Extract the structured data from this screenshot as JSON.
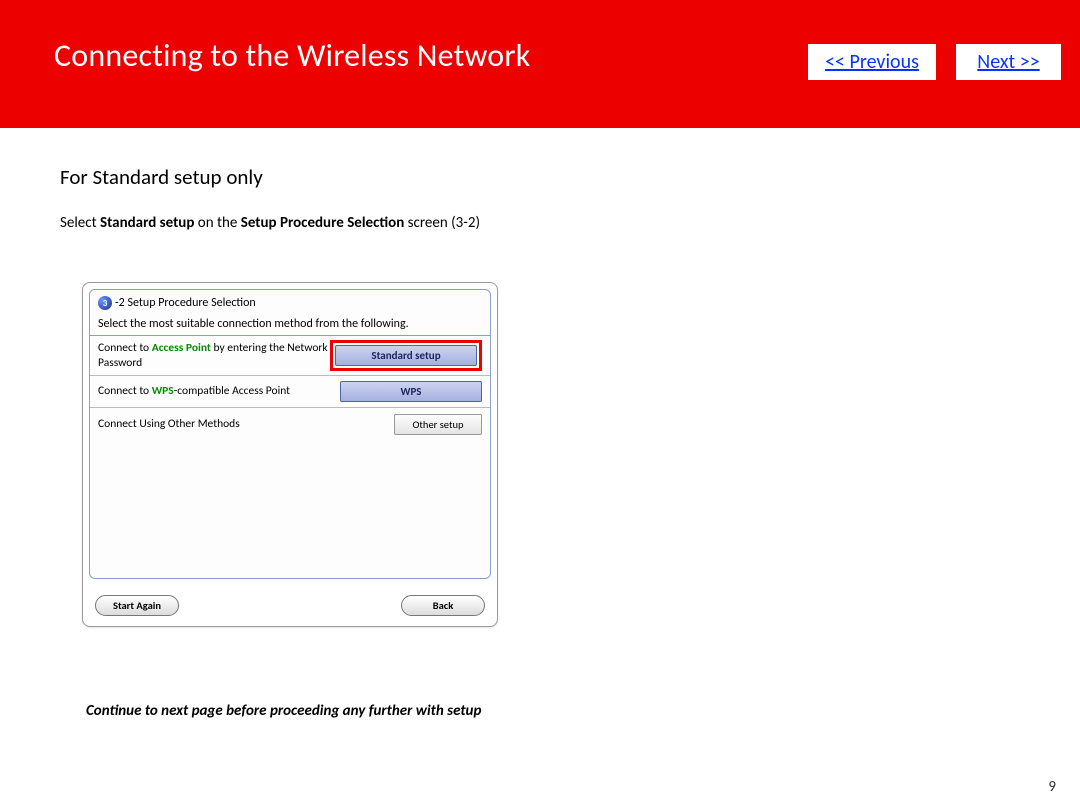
{
  "header": {
    "title": "Connecting to the Wireless Network",
    "prev_label": "<< Previous",
    "next_label": "Next >>"
  },
  "content": {
    "subheading": "For Standard setup only",
    "instruction_prefix": "Select ",
    "instruction_bold1": "Standard setup",
    "instruction_mid": " on the ",
    "instruction_bold2": "Setup Procedure Selection",
    "instruction_suffix": " screen  (3-2)"
  },
  "dialog": {
    "step_num": "3",
    "title": " -2 Setup Procedure Selection",
    "prompt": "Select the most suitable connection method from the following.",
    "options": [
      {
        "label_pre": "Connect to ",
        "label_green": "Access Point",
        "label_post": " by entering the Network Password",
        "button": "Standard setup",
        "size": "lg",
        "highlighted": true
      },
      {
        "label_pre": "Connect to ",
        "label_green": "WPS",
        "label_post": "-compatible Access Point",
        "button": "WPS",
        "size": "lg",
        "highlighted": false
      },
      {
        "label_pre": "Connect Using Other Methods",
        "label_green": "",
        "label_post": "",
        "button": "Other setup",
        "size": "sm",
        "highlighted": false
      }
    ],
    "footer": {
      "start_again": "Start Again",
      "back": "Back"
    }
  },
  "footnote": "Continue to next page before proceeding any further with setup",
  "page_number": "9"
}
